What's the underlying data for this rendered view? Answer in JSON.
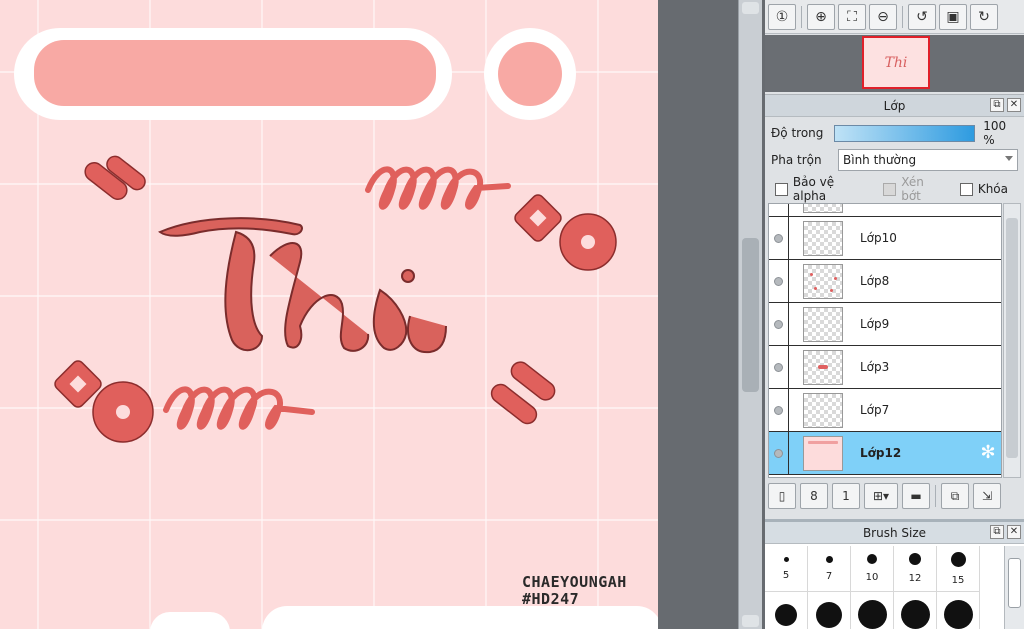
{
  "canvas": {
    "artwork_text": "Thi",
    "signature_line1": "CHAEYOUNGAH",
    "signature_line2": "#HD247"
  },
  "navigator_toolbar": {
    "buttons": [
      "zoom-actual-icon",
      "zoom-in-icon",
      "fit-window-icon",
      "zoom-out-icon",
      "rotate-left-icon",
      "fullscreen-icon",
      "rotate-right-icon"
    ]
  },
  "layer_panel": {
    "title": "Lớp",
    "opacity_label": "Độ trong",
    "opacity_value": "100 %",
    "opacity_fraction": 1.0,
    "blend_label": "Pha trộn",
    "blend_value": "Bình thường",
    "protect_alpha": "Bảo vệ alpha",
    "clipping": "Xén bớt",
    "lock": "Khóa",
    "layers": [
      {
        "name": "Lớp10",
        "active": false,
        "thumb": "transparent"
      },
      {
        "name": "Lớp8",
        "active": false,
        "thumb": "dots"
      },
      {
        "name": "Lớp9",
        "active": false,
        "thumb": "transparent"
      },
      {
        "name": "Lớp3",
        "active": false,
        "thumb": "text"
      },
      {
        "name": "Lớp7",
        "active": false,
        "thumb": "transparent"
      },
      {
        "name": "Lớp12",
        "active": true,
        "thumb": "pink"
      }
    ]
  },
  "brush_panel": {
    "title": "Brush Size",
    "sizes": [
      "5",
      "7",
      "10",
      "12",
      "15"
    ]
  },
  "colors": {
    "canvas_bg": "#fddcdc",
    "art": "#e0605c",
    "selected_layer": "#7fd0f8",
    "opacity_bar": "#2e9be0"
  }
}
